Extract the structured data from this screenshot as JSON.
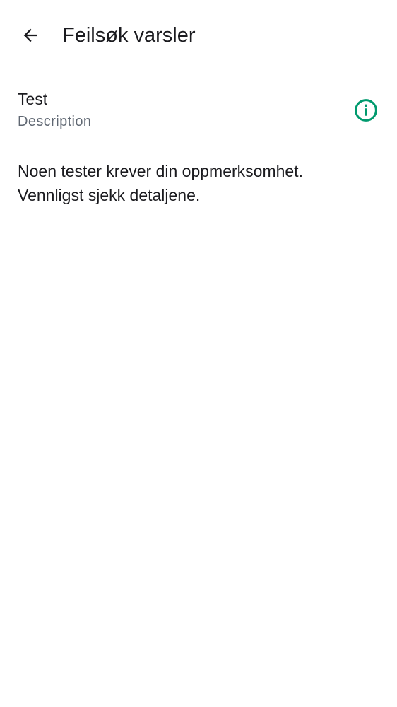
{
  "header": {
    "back_icon": "arrow-back-icon",
    "title": "Feilsøk varsler"
  },
  "test_item": {
    "title": "Test",
    "description": "Description",
    "info_icon": "info-icon",
    "info_icon_color": "#009a6e"
  },
  "message": {
    "line1": "Noen tester krever din oppmerksomhet.",
    "line2": "Vennligst sjekk detaljene."
  }
}
